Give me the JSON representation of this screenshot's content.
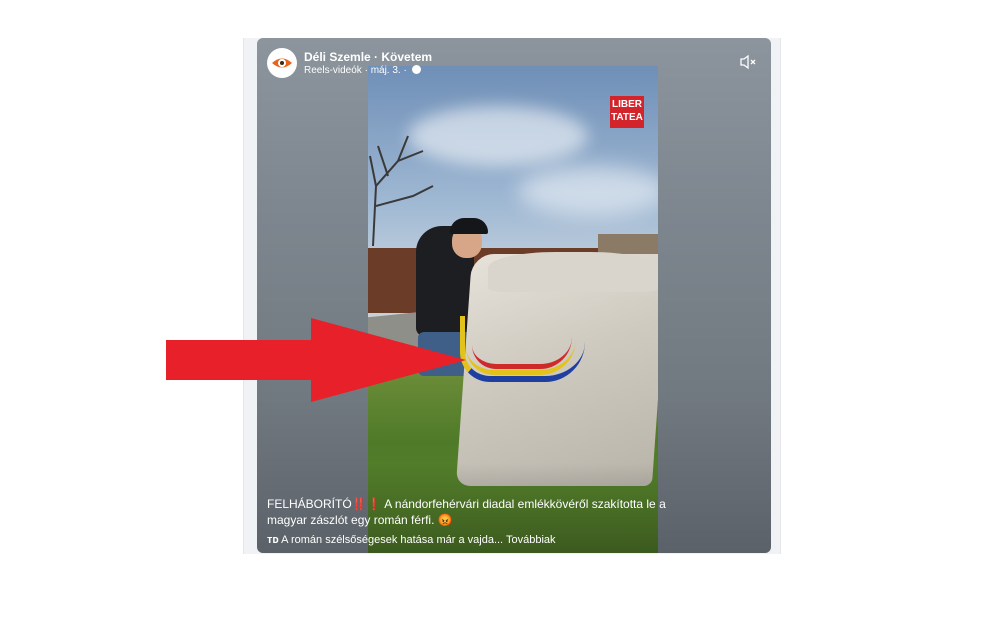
{
  "post": {
    "page_name": "Déli Szemle · Követem",
    "meta": "Reels-videók · máj. 3. ·",
    "watermark": [
      "LIBER",
      "TATEA"
    ],
    "caption_headline": "FELHÁBORÍTÓ",
    "caption_exclaim": "‼️❗",
    "caption_text": " A nándorfehérvári diadal emlékkövéről szakította le a magyar zászlót egy román férfi.",
    "caption_emoji": "😡",
    "caption_line2_prefix": "тᴅ",
    "caption_line2": " A román szélsőségesek hatása már a vajda...",
    "see_more": "Továbbiak"
  },
  "colors": {
    "arrow": "#e8202a",
    "avatar_accent": "#e8641c",
    "watermark_bg": "#d3242b"
  },
  "icons": {
    "avatar": "eye-logo-icon",
    "audience": "globe-icon",
    "mute": "speaker-muted-icon"
  }
}
